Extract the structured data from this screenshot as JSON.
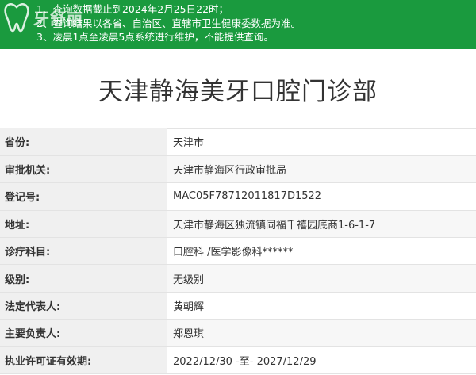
{
  "notice": {
    "lines": [
      "1、查询数据截止到2024年2月25日22时；",
      "2、查询结果以各省、自治区、直辖市卫生健康委数据为准。",
      "3、凌晨1点至凌晨5点系统进行维护，不能提供查询。"
    ]
  },
  "logo": {
    "text": "牙舒丽",
    "icon": "tooth-icon"
  },
  "page_title": "天津静海美牙口腔门诊部",
  "fields": [
    {
      "label": "省份:",
      "value": "天津市"
    },
    {
      "label": "审批机关:",
      "value": "天津市静海区行政审批局"
    },
    {
      "label": "登记号:",
      "value": "MAC05F78712011817D1522"
    },
    {
      "label": "地址:",
      "value": "天津市静海区独流镇同福千禧园底商1-6-1-7"
    },
    {
      "label": "诊疗科目:",
      "value": "口腔科 /医学影像科******"
    },
    {
      "label": "级别:",
      "value": "无级别"
    },
    {
      "label": "法定代表人:",
      "value": "黄朝辉"
    },
    {
      "label": "主要负责人:",
      "value": "郑恩琪"
    },
    {
      "label": "执业许可证有效期:",
      "value": "2022/12/30 -至- 2027/12/29"
    }
  ],
  "colors": {
    "notice_bg": "#1a9a3e",
    "label_bg": "#f0f0f0",
    "text": "#333333"
  }
}
